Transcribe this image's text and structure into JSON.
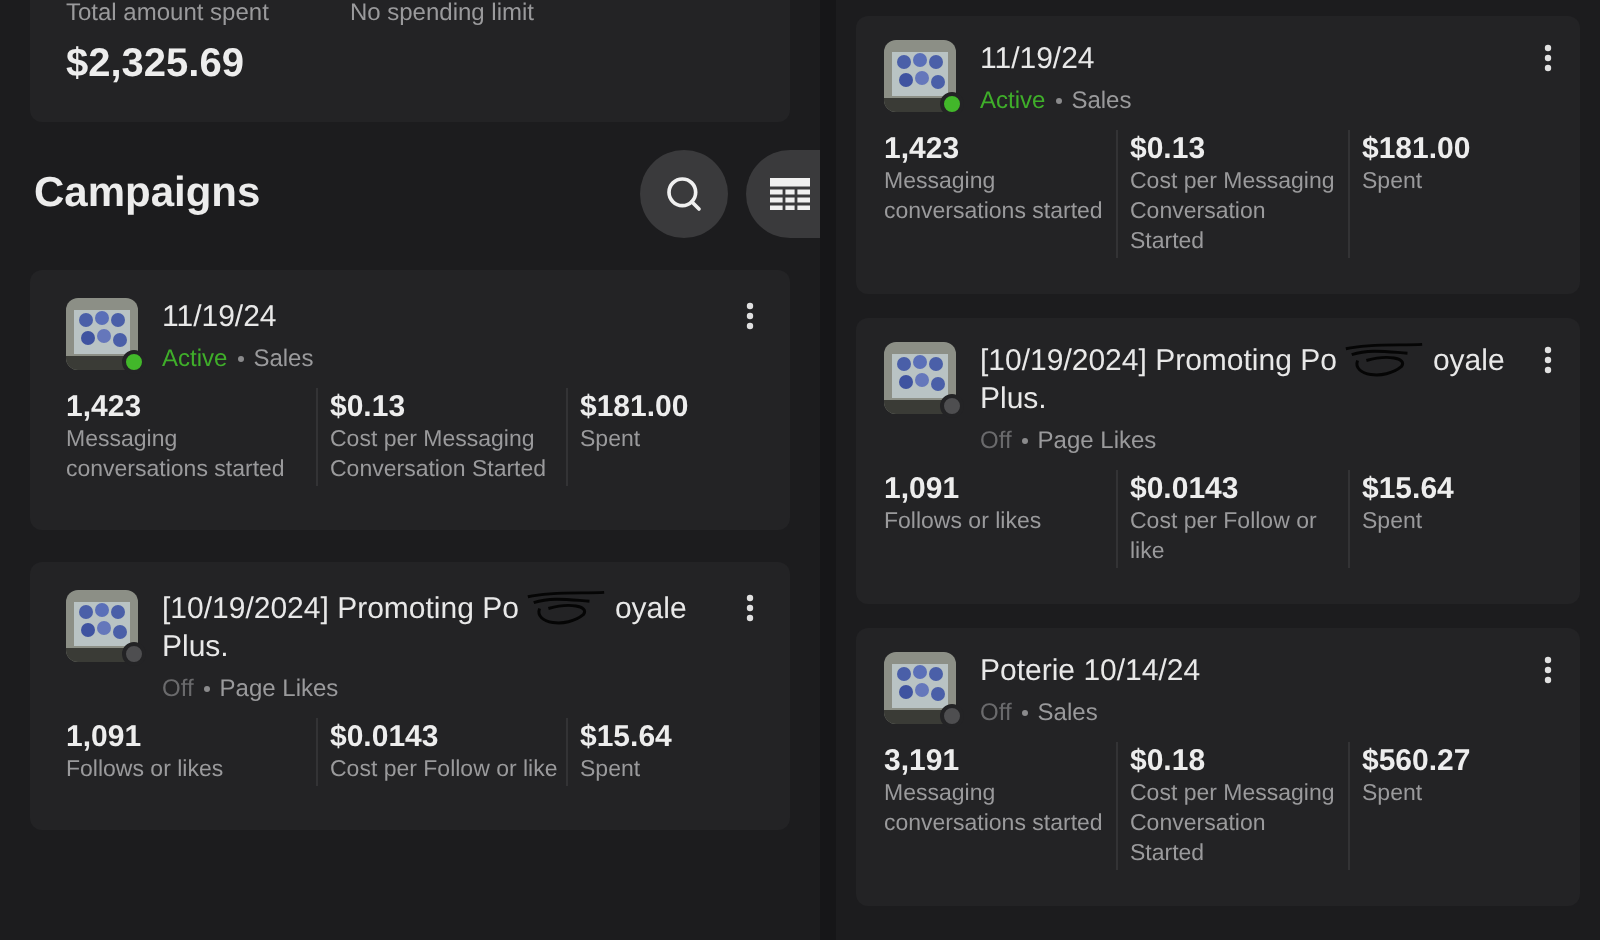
{
  "left_screen": {
    "summary": {
      "total_label": "Total amount spent",
      "total_value": "$2,325.69",
      "limit_label": "No spending limit"
    },
    "section_title": "Campaigns",
    "campaigns": [
      {
        "title_start": "11/19/24",
        "redacted": false,
        "active": true,
        "status_label": "Active",
        "objective": "Sales",
        "metrics": [
          {
            "value": "1,423",
            "label": "Messaging conversations started"
          },
          {
            "value": "$0.13",
            "label": "Cost per Messaging Conversation Started"
          },
          {
            "value": "$181.00",
            "label": "Spent"
          }
        ]
      },
      {
        "title_start": "[10/19/2024] Promoting Po",
        "redacted": true,
        "title_end": "oyale",
        "title_line2": "Plus.",
        "active": false,
        "status_label": "Off",
        "objective": "Page Likes",
        "metrics": [
          {
            "value": "1,091",
            "label": "Follows or likes"
          },
          {
            "value": "$0.0143",
            "label": "Cost per Follow or like"
          },
          {
            "value": "$15.64",
            "label": "Spent"
          }
        ]
      }
    ]
  },
  "right_screen": {
    "campaigns": [
      {
        "title_start": "11/19/24",
        "redacted": false,
        "active": true,
        "status_label": "Active",
        "objective": "Sales",
        "metrics": [
          {
            "value": "1,423",
            "label": "Messaging conversations started"
          },
          {
            "value": "$0.13",
            "label": "Cost per Messaging Conversation Started"
          },
          {
            "value": "$181.00",
            "label": "Spent"
          }
        ]
      },
      {
        "title_start": "[10/19/2024] Promoting Po",
        "redacted": true,
        "title_end": "oyale",
        "title_line2": "Plus.",
        "active": false,
        "status_label": "Off",
        "objective": "Page Likes",
        "metrics": [
          {
            "value": "1,091",
            "label": "Follows or likes"
          },
          {
            "value": "$0.0143",
            "label": "Cost per Follow or like"
          },
          {
            "value": "$15.64",
            "label": "Spent"
          }
        ]
      },
      {
        "title_start": "Poterie 10/14/24",
        "redacted": false,
        "active": false,
        "status_label": "Off",
        "objective": "Sales",
        "metrics": [
          {
            "value": "3,191",
            "label": "Messaging conversations started"
          },
          {
            "value": "$0.18",
            "label": "Cost per Messaging Conversation Started"
          },
          {
            "value": "$560.27",
            "label": "Spent"
          }
        ]
      }
    ]
  }
}
